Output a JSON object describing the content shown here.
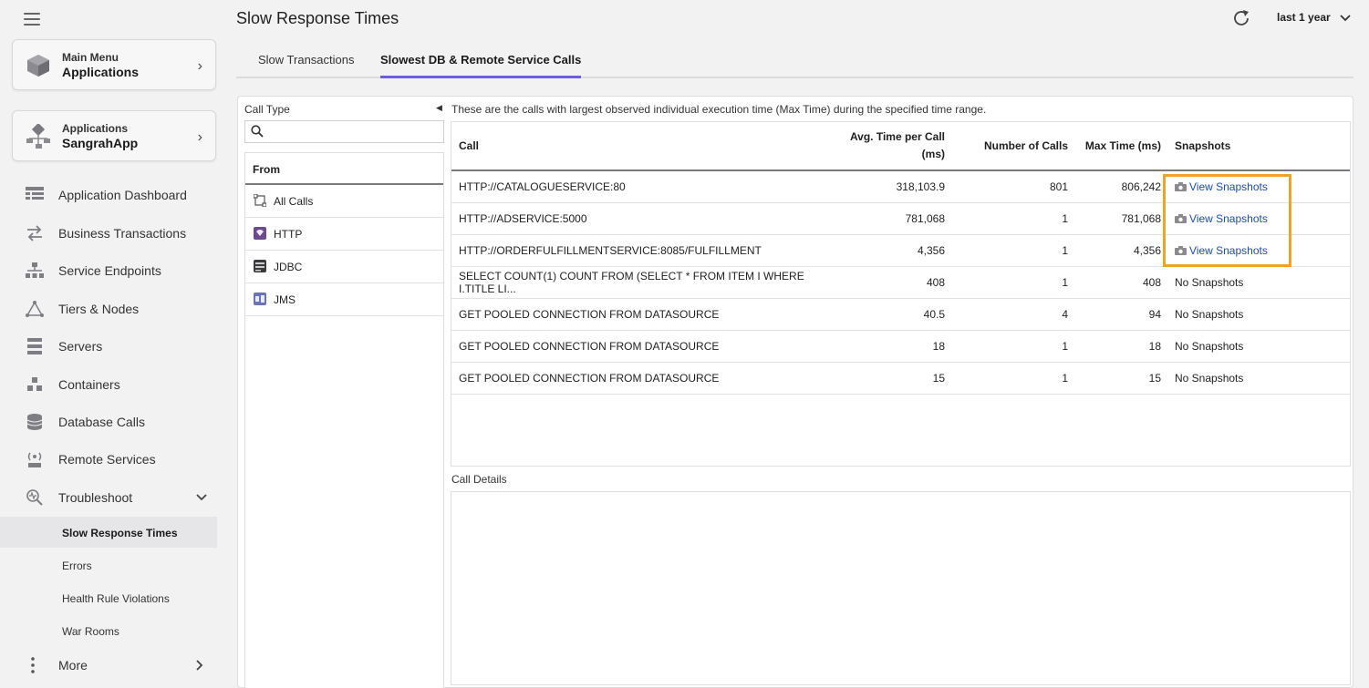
{
  "header": {
    "title": "Slow Response Times",
    "time_range": "last 1 year"
  },
  "sidebar": {
    "main_menu": {
      "small": "Main Menu",
      "big": "Applications"
    },
    "app_card": {
      "small": "Applications",
      "big": "SangrahApp"
    },
    "items": [
      {
        "label": "Application Dashboard"
      },
      {
        "label": "Business Transactions"
      },
      {
        "label": "Service Endpoints"
      },
      {
        "label": "Tiers & Nodes"
      },
      {
        "label": "Servers"
      },
      {
        "label": "Containers"
      },
      {
        "label": "Database Calls"
      },
      {
        "label": "Remote Services"
      },
      {
        "label": "Troubleshoot"
      }
    ],
    "sub_items": [
      {
        "label": "Slow Response Times"
      },
      {
        "label": "Errors"
      },
      {
        "label": "Health Rule Violations"
      },
      {
        "label": "War Rooms"
      }
    ],
    "more": "More"
  },
  "tabs": [
    {
      "label": "Slow Transactions"
    },
    {
      "label": "Slowest DB & Remote Service Calls"
    }
  ],
  "call_type": {
    "label": "Call Type",
    "search_placeholder": "",
    "column_header": "From",
    "items": [
      {
        "label": "All Calls",
        "icon": "all-calls-icon"
      },
      {
        "label": "HTTP",
        "icon": "http-icon"
      },
      {
        "label": "JDBC",
        "icon": "jdbc-icon"
      },
      {
        "label": "JMS",
        "icon": "jms-icon"
      }
    ]
  },
  "calls": {
    "description": "These are the calls with largest observed individual execution time (Max Time) during the specified time range.",
    "columns": {
      "call": "Call",
      "avg_line1": "Avg. Time per Call",
      "avg_line2": "(ms)",
      "num": "Number of Calls",
      "max": "Max Time (ms)",
      "snap": "Snapshots"
    },
    "rows": [
      {
        "call": "HTTP://CATALOGUESERVICE:80",
        "avg": "318,103.9",
        "num": "801",
        "max": "806,242",
        "snap": "View Snapshots"
      },
      {
        "call": "HTTP://ADSERVICE:5000",
        "avg": "781,068",
        "num": "1",
        "max": "781,068",
        "snap": "View Snapshots"
      },
      {
        "call": "HTTP://ORDERFULFILLMENTSERVICE:8085/FULFILLMENT",
        "avg": "4,356",
        "num": "1",
        "max": "4,356",
        "snap": "View Snapshots"
      },
      {
        "call": "SELECT COUNT(1) COUNT FROM (SELECT * FROM ITEM I WHERE I.TITLE LI...",
        "avg": "408",
        "num": "1",
        "max": "408",
        "snap": "No Snapshots"
      },
      {
        "call": "GET POOLED CONNECTION FROM DATASOURCE",
        "avg": "40.5",
        "num": "4",
        "max": "94",
        "snap": "No Snapshots"
      },
      {
        "call": "GET POOLED CONNECTION FROM DATASOURCE",
        "avg": "18",
        "num": "1",
        "max": "18",
        "snap": "No Snapshots"
      },
      {
        "call": "GET POOLED CONNECTION FROM DATASOURCE",
        "avg": "15",
        "num": "1",
        "max": "15",
        "snap": "No Snapshots"
      }
    ]
  },
  "call_details": {
    "label": "Call Details"
  },
  "colors": {
    "accent": "#6b5de0",
    "link": "#1c4db8",
    "highlight": "#f3a324"
  }
}
